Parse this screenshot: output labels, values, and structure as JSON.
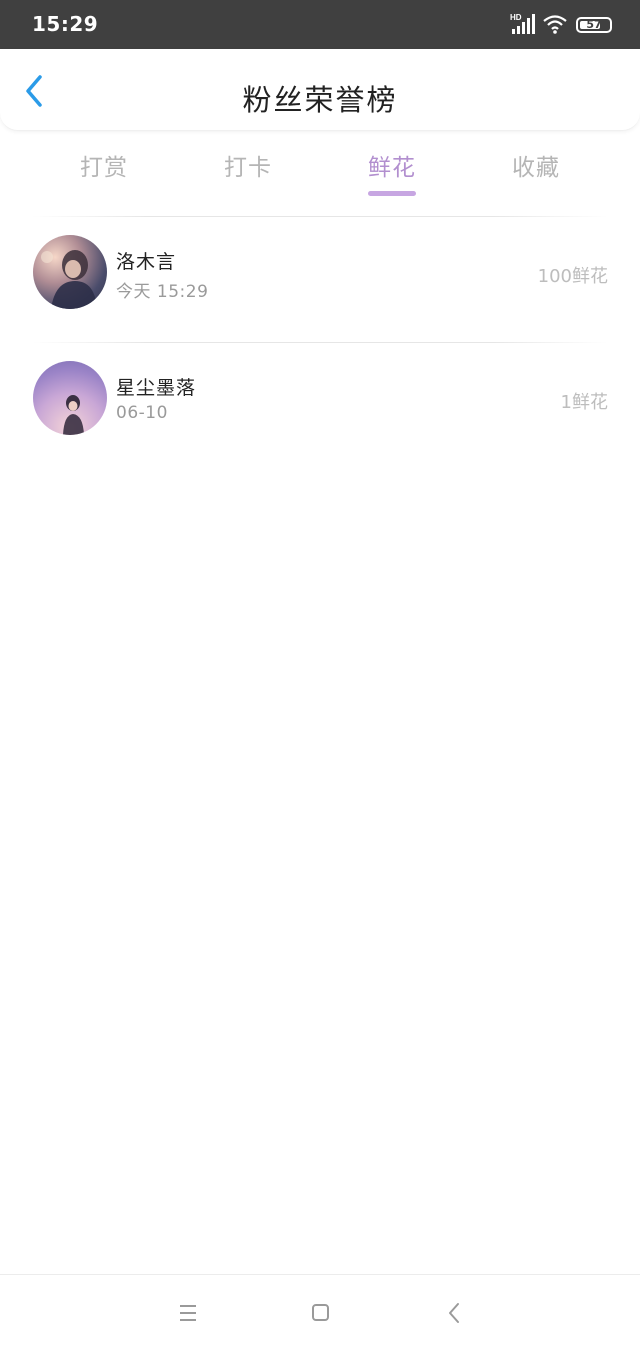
{
  "status_bar": {
    "time": "15:29",
    "network_label": "HD",
    "battery_level": "57",
    "icons": [
      "signal-icon",
      "wifi-icon",
      "battery-icon"
    ]
  },
  "header": {
    "title": "粉丝荣誉榜",
    "back_icon": "chevron-left-icon"
  },
  "tabs": [
    {
      "label": "打赏",
      "active": false
    },
    {
      "label": "打卡",
      "active": false
    },
    {
      "label": "鲜花",
      "active": true
    },
    {
      "label": "收藏",
      "active": false
    }
  ],
  "fans": [
    {
      "name": "洛木言",
      "time": "今天 15:29",
      "count": "100鲜花"
    },
    {
      "name": "星尘墨落",
      "time": "06-10",
      "count": "1鲜花"
    }
  ],
  "colors": {
    "status_bar_bg": "#404040",
    "accent_back": "#2b9be8",
    "accent_tab": "#b28fcf",
    "indicator": "#c7a6e2",
    "muted_text": "#b5b5b5"
  },
  "nav_bar": {
    "icons": [
      "menu-icon",
      "home-icon",
      "back-icon"
    ]
  }
}
